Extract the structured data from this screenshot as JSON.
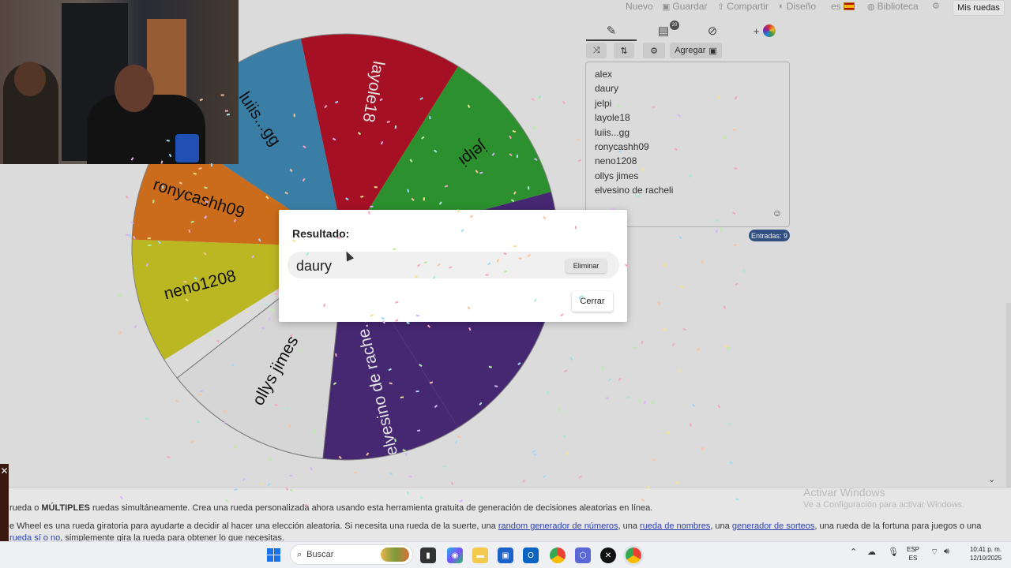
{
  "nav": {
    "nuevo": "Nuevo",
    "guardar": "Guardar",
    "compartir": "Compartir",
    "diseno": "Diseño",
    "lang": "es",
    "biblioteca": "Biblioteca",
    "mis_ruedas": "Mis ruedas"
  },
  "wheel": {
    "segments": [
      {
        "label": "luiis...gg",
        "color": "#3e86b0"
      },
      {
        "label": "layole18",
        "color": "#b01228"
      },
      {
        "label": "jelpi",
        "color": "#2e9a30"
      },
      {
        "label": "alex",
        "color": "#4a2a7a"
      },
      {
        "label": "elvesino de rache...",
        "color": "#4a2a7a"
      },
      {
        "label": "ollys jimes",
        "color": "#e4e4e4"
      },
      {
        "label": "neno1208",
        "color": "#c7c326"
      },
      {
        "label": "ronycashh09",
        "color": "#d8731e"
      }
    ]
  },
  "editor": {
    "add_image_label": "Agregar",
    "entries": [
      "alex",
      "daury",
      "jelpi",
      "layole18",
      "luiis...gg",
      "ronycashh09",
      "neno1208",
      "ollys jimes",
      "elvesino de racheli"
    ],
    "count_label": "Entradas: 9",
    "tab_badge": "20"
  },
  "dialog": {
    "title": "Resultado:",
    "result": "daury",
    "remove_label": "Eliminar",
    "close_label": "Cerrar"
  },
  "info": {
    "line1_pre": "rueda o ",
    "line1_bold": "MÚLTIPLES",
    "line1_post": " ruedas simultáneamente. Crea una rueda personalizada ahora usando esta herramienta gratuita de generación de decisiones aleatorias en línea.",
    "line2_pre": "e Wheel es una rueda giratoria para ayudarte a decidir al hacer una elección aleatoria. Si necesita una rueda de la suerte, una ",
    "link1": "random generador de números",
    "sep1": ", una ",
    "link2": "rueda de nombres",
    "sep2": ", una ",
    "link3": "generador de sorteos",
    "line2_post": ", una rueda de la fortuna para juegos o una",
    "link4": "rueda sí o no",
    "line3_post": ", simplemente gira la rueda para obtener lo que necesitas.",
    "activar_title": "Activar Windows",
    "activar_sub": "Ve a Configuración para activar Windows."
  },
  "taskbar": {
    "search_placeholder": "Buscar",
    "lang_top": "ESP",
    "lang_bottom": "ES",
    "time": "10:41 p. m.",
    "date": "12/10/2025"
  }
}
